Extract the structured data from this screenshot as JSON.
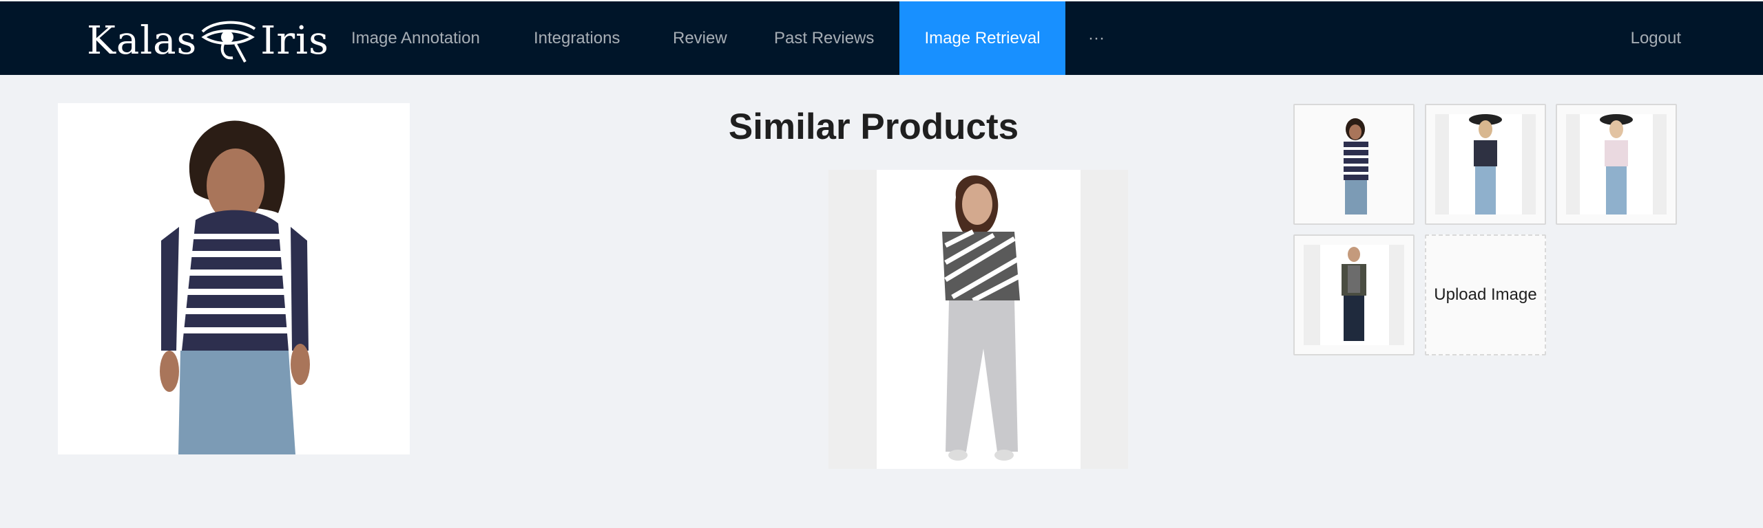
{
  "brand": {
    "name_left": "Kalas",
    "name_right": "Iris",
    "logo_icon": "eye-of-horus-icon"
  },
  "nav": {
    "items": [
      {
        "label": "Image Annotation"
      },
      {
        "label": "Integrations"
      },
      {
        "label": "Review"
      },
      {
        "label": "Past Reviews"
      },
      {
        "label": "Image Retrieval",
        "active": true
      },
      {
        "label": "···"
      }
    ],
    "logout_label": "Logout"
  },
  "main": {
    "title": "Similar Products",
    "upload_label": "Upload Image"
  },
  "colors": {
    "nav_bg": "#001529",
    "active": "#1890ff",
    "page_bg": "#f0f2f5"
  }
}
